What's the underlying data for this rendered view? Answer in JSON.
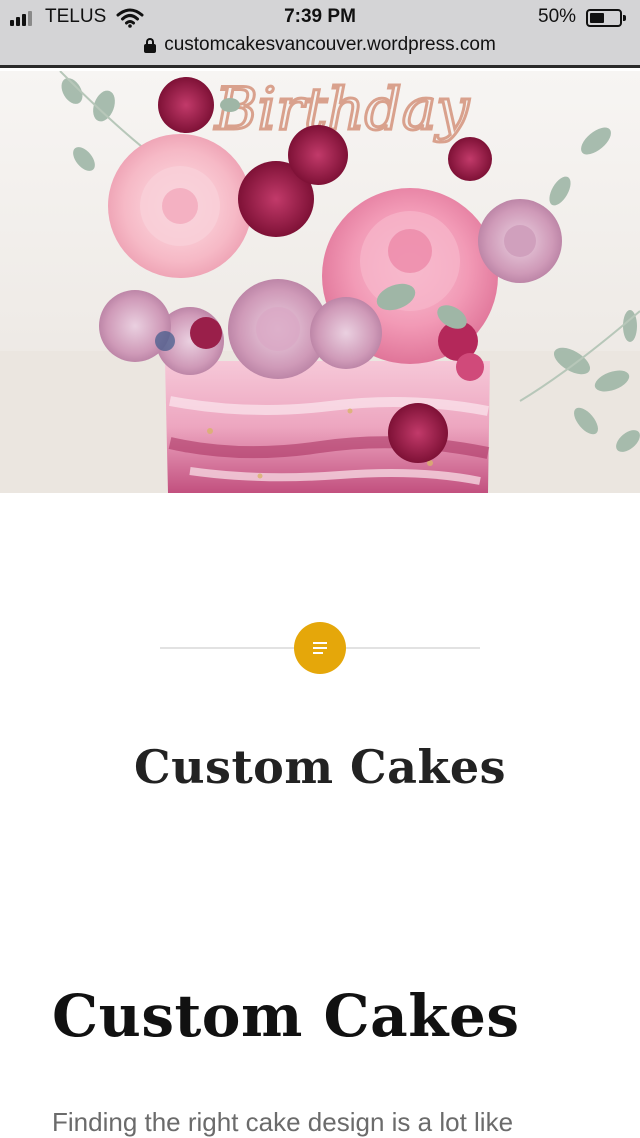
{
  "status_bar": {
    "carrier": "TELUS",
    "time": "7:39 PM",
    "battery_percent": "50%",
    "battery_level": 0.5,
    "signal_icon": "signal-bars-icon",
    "wifi_icon": "wifi-icon",
    "battery_icon": "battery-icon"
  },
  "browser": {
    "url": "customcakesvancouver.wordpress.com",
    "lock_icon": "lock-icon"
  },
  "hero": {
    "topper_text": "Birthday"
  },
  "post": {
    "format_icon": "document-icon",
    "accent_color": "#e5a70a",
    "entry_title": "Custom Cakes",
    "content_heading": "Custom Cakes",
    "content_intro": "Finding the right cake design is a lot like"
  }
}
